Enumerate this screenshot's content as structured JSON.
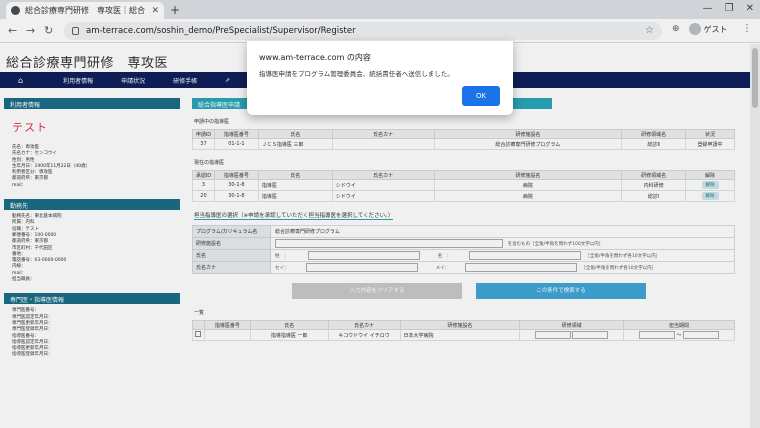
{
  "browser": {
    "tab_title": "総合診療専門研修　専攻医｜総合",
    "url": "am-terrace.com/soshin_demo/PreSpecialist/Supervisor/Register",
    "profile_label": "ゲスト"
  },
  "site": {
    "title": "総合診療専門研修　専攻医",
    "nav": [
      "利用者情報",
      "申請状況",
      "研修手帳"
    ]
  },
  "sidebar": {
    "user_head": "利用者情報",
    "user_name": "テスト",
    "user_lines": [
      "氏名：専攻医",
      "氏名カナ：センコウイ",
      "性別：男性",
      "生年月日：1900年11月22日（40歳）",
      "利用者区分：専攻医",
      "都道府県：東京都",
      "mail："
    ],
    "work_head": "勤務先",
    "work_lines": [
      "勤務先名：東北基本病院",
      "所属：内科",
      "役職：テスト",
      "郵便番号：100-0000",
      "都道府県：東京都",
      "市区町村：千代田区",
      "番地：",
      "電話番号：03-0000-0000",
      "内線：",
      "mail：",
      "担当職員："
    ],
    "cert_head": "専門医・指導医情報",
    "cert_lines": [
      "専門医番号：",
      "専門医認定年月日：",
      "専門医更新年月日：",
      "専門医登録年月日：",
      "指導医番号：",
      "指導医認定年月日：",
      "指導医更新年月日：",
      "指導医登録年月日："
    ]
  },
  "main": {
    "header": "総合指導医申請",
    "pending_label": "申請中の指導医",
    "pending_cols": [
      "申請ID",
      "指導医番号",
      "氏名",
      "氏名カナ",
      "研修施設名",
      "研修領域名",
      "状況"
    ],
    "pending_rows": [
      [
        "37",
        "01-1-1",
        "ＪＣＳ指導医 三郎",
        "",
        "総合診療専門研修プログラム",
        "総診Ⅱ",
        "登録申請中"
      ]
    ],
    "current_label": "現在の指導医",
    "current_cols": [
      "承認ID",
      "指導医番号",
      "氏名",
      "氏名カナ",
      "研修施設名",
      "研修領域名",
      "解除"
    ],
    "current_rows": [
      [
        "3",
        "30-1-8",
        "指導医",
        "シドウイ",
        "病院",
        "内科研修",
        "解除"
      ],
      [
        "20",
        "30-1-8",
        "指導医",
        "シドウイ",
        "病院",
        "総診Ⅰ",
        "解除"
      ]
    ],
    "search_title": "担当指導医の選択（※申請を承認していただく担当指導医を選択してください。）",
    "form": {
      "program_label": "プログラム/カリキュラム名",
      "program_value": "総合診療専門研修プログラム",
      "facility_label": "研修施設名",
      "facility_note": "を含むもの［全角/半角を問わず100文字以内］",
      "name_label": "氏名",
      "sei": "姓　：",
      "mei": "名　：",
      "name_note": "［全角/半角を問わず各10文字以内］",
      "kana_label": "氏名カナ",
      "sei_kana": "セイ：",
      "mei_kana": "メイ：",
      "kana_note": "［全角/半角を問わず各10文字以内］"
    },
    "clear_button": "入力内容をクリアする",
    "search_button": "この条件で検索する",
    "list_label": "一覧",
    "list_cols": [
      "",
      "指導医番号",
      "氏名",
      "氏名カナ",
      "研修施設名",
      "研修領域",
      "担当期間"
    ],
    "list_rows": [
      [
        "",
        "",
        "指導指導医 一郎",
        "キコウドウイ イチロウ",
        "日本大学病院",
        "",
        "〜"
      ]
    ]
  },
  "dialog": {
    "title": "www.am-terrace.com の内容",
    "message": "指導医申請をプログラム管理委員会、統括責任者へ送信しました。",
    "ok_label": "OK"
  }
}
